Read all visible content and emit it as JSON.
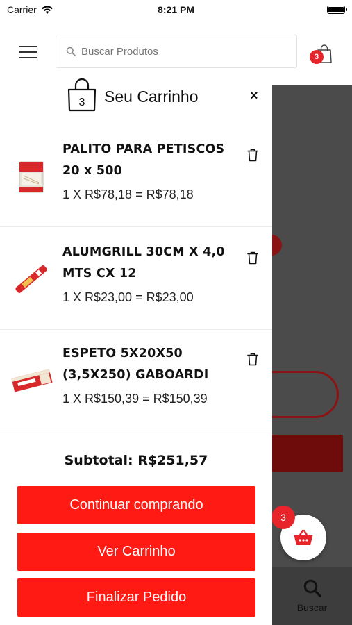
{
  "status_bar": {
    "carrier": "Carrier",
    "time": "8:21 PM"
  },
  "header": {
    "search_placeholder": "Buscar Produtos",
    "cart_count": "3"
  },
  "cart": {
    "bag_count": "3",
    "title": "Seu Carrinho",
    "close_label": "×",
    "items": [
      {
        "name_line1": "PALITO PARA PETISCOS",
        "name_line2": "20 x 500",
        "price_line": "1 X R$78,18 = R$78,18"
      },
      {
        "name_line1": "ALUMGRILL 30CM X 4,0",
        "name_line2": "MTS CX 12",
        "price_line": "1 X R$23,00 = R$23,00"
      },
      {
        "name_line1": "ESPETO 5X20X50",
        "name_line2": "(3,5X250) GABOARDI",
        "price_line": "1 X R$150,39 = R$150,39"
      }
    ],
    "subtotal": "Subtotal: R$251,57",
    "buttons": {
      "continue": "Continuar comprando",
      "view_cart": "Ver Carrinho",
      "checkout": "Finalizar Pedido"
    }
  },
  "background": {
    "fab_badge": "3",
    "nav_search_label": "Buscar"
  },
  "colors": {
    "accent": "#ff1a14",
    "badge": "#e8242b"
  },
  "icons": [
    "hamburger-menu-icon",
    "search-icon",
    "shopping-bag-icon",
    "close-icon",
    "trash-icon",
    "basket-icon",
    "wifi-icon",
    "battery-icon"
  ]
}
